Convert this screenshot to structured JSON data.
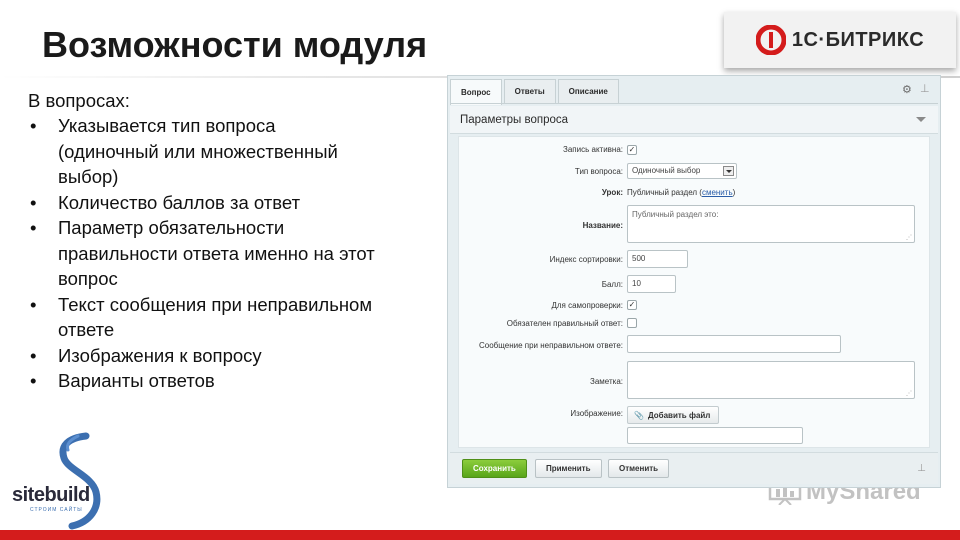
{
  "slide": {
    "title": "Возможности модуля",
    "intro": "В вопросах:",
    "bullets": [
      "Указывается тип вопроса (одиночный или множественный выбор)",
      "Количество баллов за ответ",
      "Параметр обязательности правильности ответа именно на этот вопрос",
      "Текст сообщения при неправильном ответе",
      "Изображения к вопросу",
      "Варианты ответов"
    ]
  },
  "brand": {
    "text": "1С·БИТРИКС",
    "color": "#d41c1c"
  },
  "sitebuild": {
    "name": "sitebuild",
    "tagline": "СТРОИМ САЙТЫ"
  },
  "watermark": {
    "text": "MyShared"
  },
  "panel": {
    "tabs": [
      {
        "label": "Вопрос",
        "active": true
      },
      {
        "label": "Ответы",
        "active": false
      },
      {
        "label": "Описание",
        "active": false
      }
    ],
    "section_title": "Параметры вопроса",
    "fields": {
      "active": {
        "label": "Запись активна:",
        "checked": true
      },
      "type": {
        "label": "Тип вопроса:",
        "value": "Одиночный выбор"
      },
      "lesson": {
        "label": "Урок:",
        "value": "Публичный раздел",
        "link": "сменить"
      },
      "name": {
        "label": "Название:",
        "value": "Публичный раздел это:"
      },
      "sort": {
        "label": "Индекс сортировки:",
        "value": "500"
      },
      "score": {
        "label": "Балл:",
        "value": "10"
      },
      "self_check": {
        "label": "Для самопроверки:",
        "checked": true
      },
      "required": {
        "label": "Обязателен правильный ответ:",
        "checked": false
      },
      "wrong_msg": {
        "label": "Сообщение при неправильном ответе:",
        "value": ""
      },
      "note": {
        "label": "Заметка:",
        "value": ""
      },
      "image": {
        "label": "Изображение:",
        "button": "Добавить файл",
        "value": ""
      }
    },
    "buttons": {
      "save": "Сохранить",
      "apply": "Применить",
      "cancel": "Отменить"
    }
  },
  "colors": {
    "accent_red": "#d41c1c",
    "save_green": "#58a51a",
    "link_blue": "#2a5da8"
  }
}
